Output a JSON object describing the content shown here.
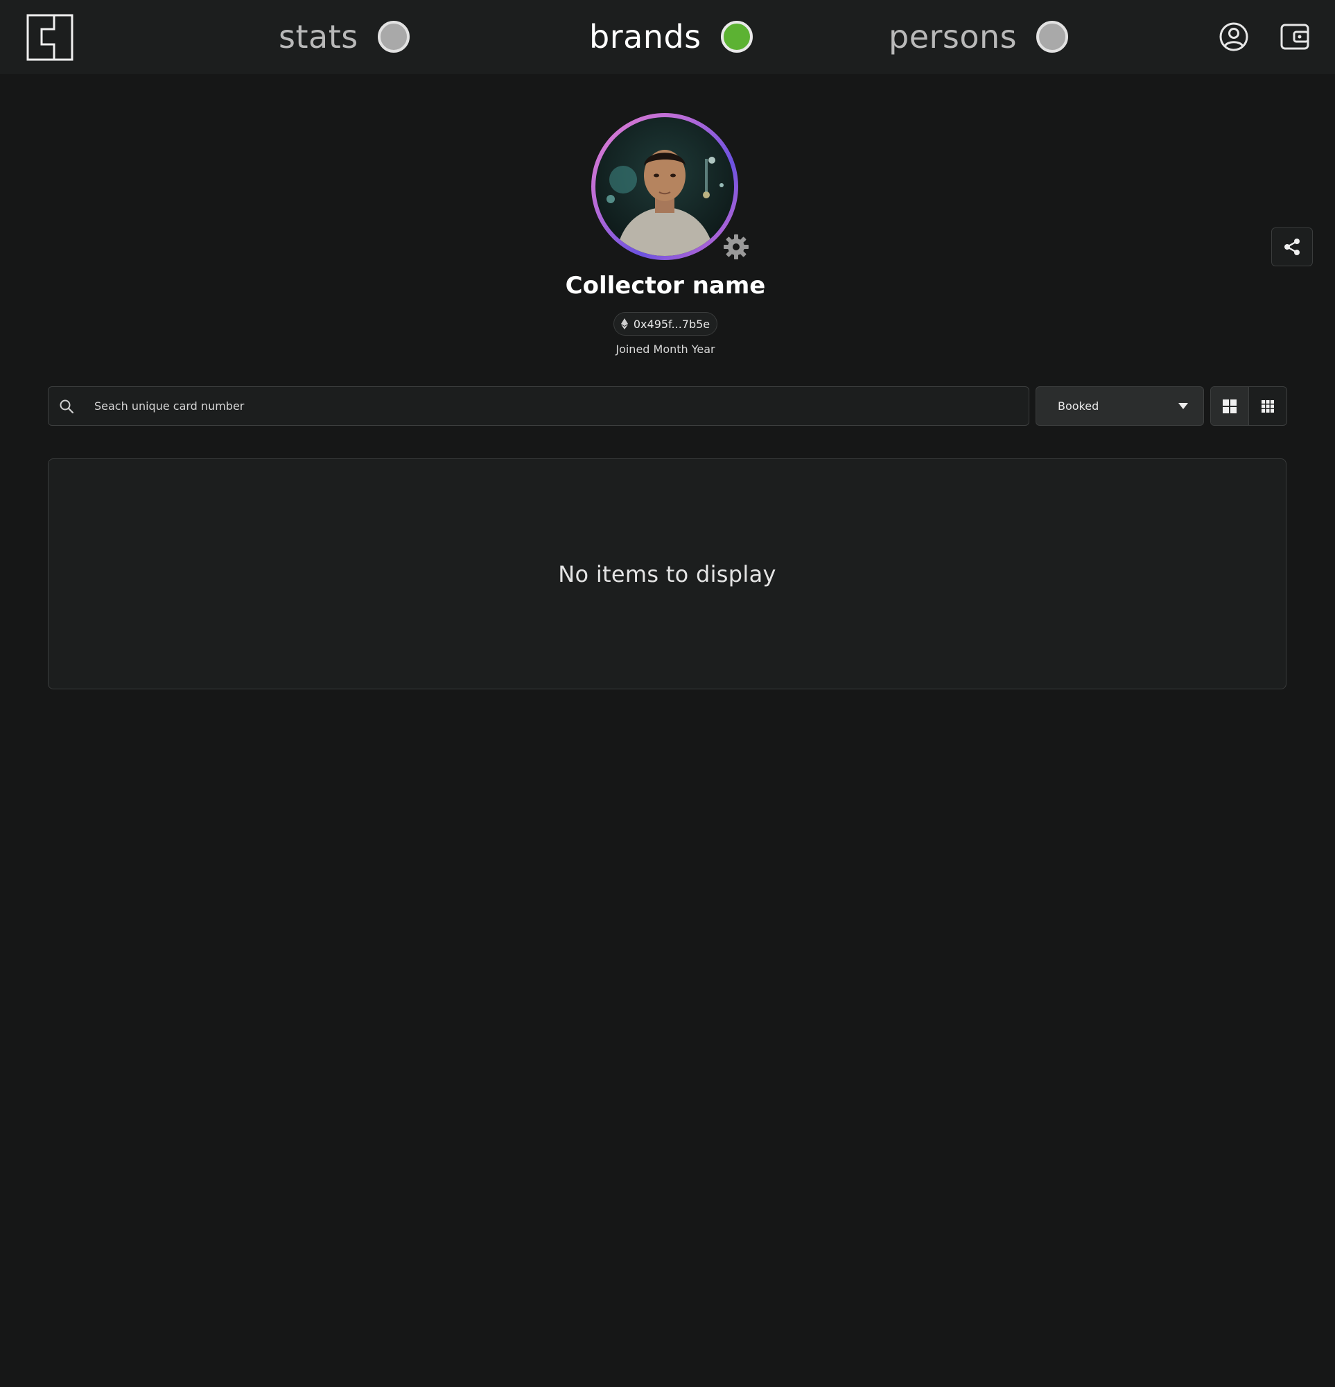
{
  "nav": {
    "items": [
      {
        "label": "stats",
        "active": false
      },
      {
        "label": "brands",
        "active": true
      },
      {
        "label": "persons",
        "active": false
      }
    ]
  },
  "profile": {
    "name": "Collector name",
    "address": "0x495f...7b5e",
    "joined": "Joined Month Year"
  },
  "search": {
    "placeholder": "Seach unique card number",
    "value": ""
  },
  "filter": {
    "selected": "Booked"
  },
  "view": {
    "active": "large-grid"
  },
  "items": {
    "empty_message": "No items to display"
  },
  "colors": {
    "background": "#161717",
    "topbar": "#1c1e1e",
    "active_indicator": "#5cb233",
    "inactive_indicator": "#a9a9a9",
    "avatar_ring_start": "#e57fd0",
    "avatar_ring_mid": "#6b52e0"
  }
}
